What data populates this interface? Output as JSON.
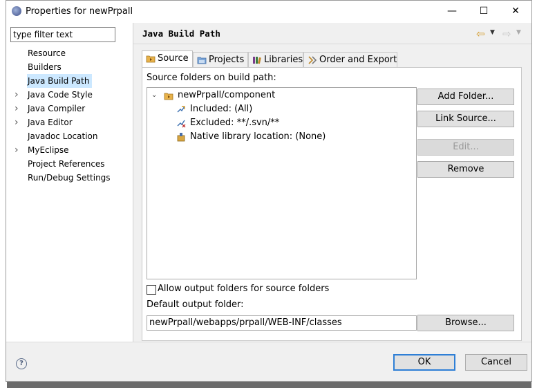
{
  "window": {
    "title": "Properties for newPrpall",
    "minimize": "—",
    "maximize": "☐",
    "close": "✕"
  },
  "filter": {
    "value": "type filter text"
  },
  "nav_tree": [
    {
      "label": "Resource",
      "expandable": false,
      "selected": false
    },
    {
      "label": "Builders",
      "expandable": false,
      "selected": false
    },
    {
      "label": "Java Build Path",
      "expandable": false,
      "selected": true
    },
    {
      "label": "Java Code Style",
      "expandable": true,
      "selected": false
    },
    {
      "label": "Java Compiler",
      "expandable": true,
      "selected": false
    },
    {
      "label": "Java Editor",
      "expandable": true,
      "selected": false
    },
    {
      "label": "Javadoc Location",
      "expandable": false,
      "selected": false
    },
    {
      "label": "MyEclipse",
      "expandable": true,
      "selected": false
    },
    {
      "label": "Project References",
      "expandable": false,
      "selected": false
    },
    {
      "label": "Run/Debug Settings",
      "expandable": false,
      "selected": false
    }
  ],
  "page": {
    "title": "Java Build Path",
    "back_icon": "back-arrow-icon",
    "forward_icon": "forward-arrow-icon"
  },
  "tabs": [
    {
      "label": "Source",
      "active": true,
      "icon": "source-folder-icon"
    },
    {
      "label": "Projects",
      "active": false,
      "icon": "projects-icon"
    },
    {
      "label": "Libraries",
      "active": false,
      "icon": "libraries-icon"
    },
    {
      "label": "Order and Export",
      "active": false,
      "icon": "order-export-icon"
    }
  ],
  "source": {
    "heading": "Source folders on build path:",
    "root": "newPrpall/component",
    "children": [
      {
        "label": "Included: (All)",
        "icon": "included-filter-icon"
      },
      {
        "label": "Excluded: **/.svn/**",
        "icon": "excluded-filter-icon"
      },
      {
        "label": "Native library location: (None)",
        "icon": "native-library-icon"
      }
    ]
  },
  "buttons": {
    "add_folder": "Add Folder...",
    "link_source": "Link Source...",
    "edit": "Edit...",
    "remove": "Remove",
    "browse": "Browse...",
    "ok": "OK",
    "cancel": "Cancel"
  },
  "output": {
    "allow_label": "Allow output folders for source folders",
    "allow_checked": false,
    "default_label": "Default output folder:",
    "default_value": "newPrpall/webapps/prpall/WEB-INF/classes"
  },
  "colors": {
    "selection": "#cce8ff",
    "ok_border": "#2e7fd6",
    "folder": "#e8b24a"
  }
}
